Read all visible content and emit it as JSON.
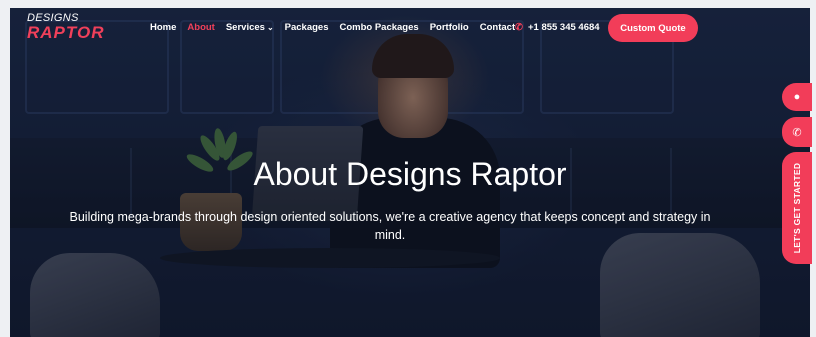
{
  "logo": {
    "line1": "DESIGNS",
    "line2": "RAPTOR"
  },
  "nav": {
    "items": [
      {
        "label": "Home",
        "active": false
      },
      {
        "label": "About",
        "active": true
      },
      {
        "label": "Services",
        "active": false,
        "dropdown": true
      },
      {
        "label": "Packages",
        "active": false
      },
      {
        "label": "Combo Packages",
        "active": false
      },
      {
        "label": "Portfolio",
        "active": false
      },
      {
        "label": "Contact",
        "active": false
      }
    ],
    "dropdown_icon": "chevron-down-icon"
  },
  "phone": {
    "icon": "phone-icon",
    "number": "+1 855 345 4684"
  },
  "cta": {
    "label": "Custom Quote"
  },
  "hero": {
    "title": "About Designs Raptor",
    "subtitle": "Building mega-brands through design oriented solutions, we're a creative agency that keeps concept and strategy in mind."
  },
  "side": {
    "chat_icon": "chat-icon",
    "phone_icon": "phone-icon",
    "started_label": "LET'S GET STARTED"
  },
  "colors": {
    "accent": "#f23d59",
    "background": "#1a2540",
    "text": "#ffffff"
  }
}
